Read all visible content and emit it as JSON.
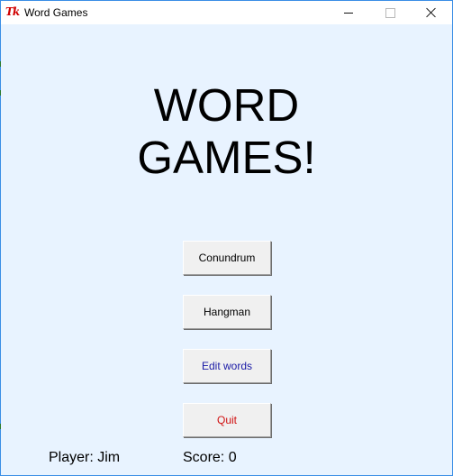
{
  "window": {
    "title": "Word Games",
    "app_icon": "tk-icon",
    "app_icon_text": "Tk",
    "controls": {
      "minimize": "minimize-icon",
      "maximize": "maximize-icon",
      "close": "close-icon"
    }
  },
  "heading": {
    "line1": "WORD",
    "line2": "GAMES!"
  },
  "menu": {
    "conundrum_label": "Conundrum",
    "hangman_label": "Hangman",
    "edit_words_label": "Edit words",
    "quit_label": "Quit"
  },
  "status": {
    "player": "Player: Jim",
    "score": "Score: 0"
  },
  "colors": {
    "background": "#e8f3ff",
    "edit_words_text": "#1a1aa6",
    "quit_text": "#d01010"
  }
}
